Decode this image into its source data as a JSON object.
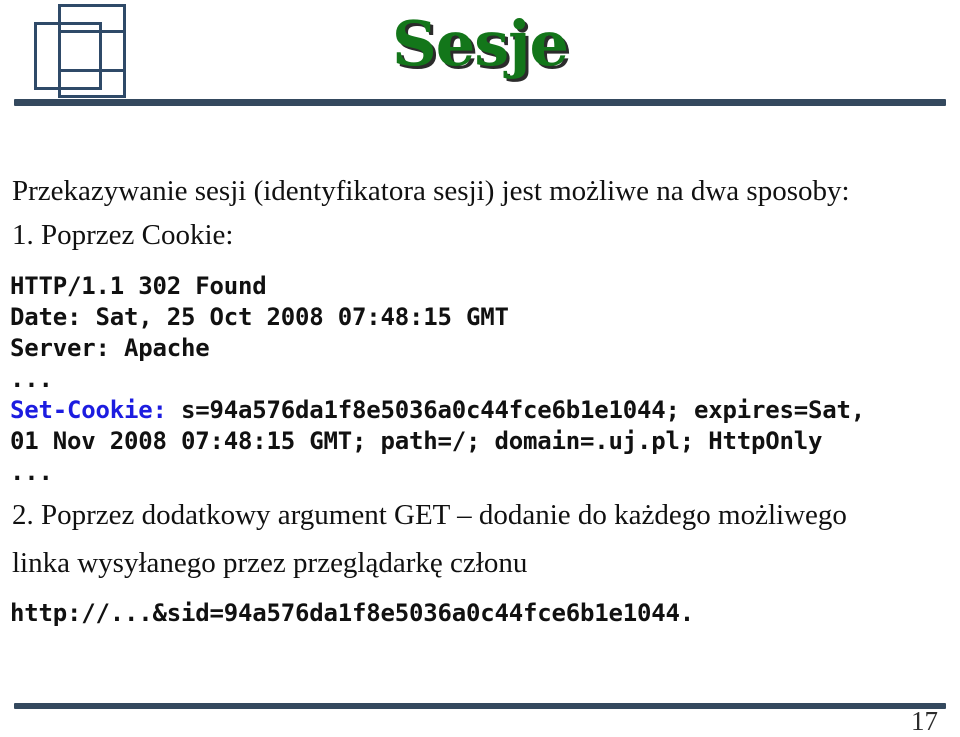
{
  "slide": {
    "title": "Sesje",
    "page_number": "17",
    "accent_color": "#34495e",
    "title_color": "#13761a",
    "keyword_color": "#1c1ce0",
    "background_color": "#ffffff"
  },
  "logo": {
    "name": "three-overlapping-squares-logo",
    "stroke_color": "#2f4a68"
  },
  "content": {
    "intro": "Przekazywanie sesji (identyfikatora sesji) jest możliwe na dwa sposoby:",
    "item1": "1. Poprzez Cookie:",
    "http": {
      "line1": "HTTP/1.1 302 Found",
      "line2": "Date: Sat, 25 Oct 2008 07:48:15 GMT",
      "line3": "Server: Apache",
      "line4": "...",
      "set_cookie_key": "Set-Cookie:",
      "set_cookie_value": " s=94a576da1f8e5036a0c44fce6b1e1044; expires=Sat,",
      "line6": "01 Nov 2008 07:48:15 GMT; path=/; domain=.uj.pl; HttpOnly",
      "line7": "..."
    },
    "item2_line1": "2. Poprzez dodatkowy argument GET – dodanie do każdego możliwego",
    "item2_line2": "linka wysyłanego przez przeglądarkę członu",
    "get_example": "http://...&sid=94a576da1f8e5036a0c44fce6b1e1044."
  }
}
